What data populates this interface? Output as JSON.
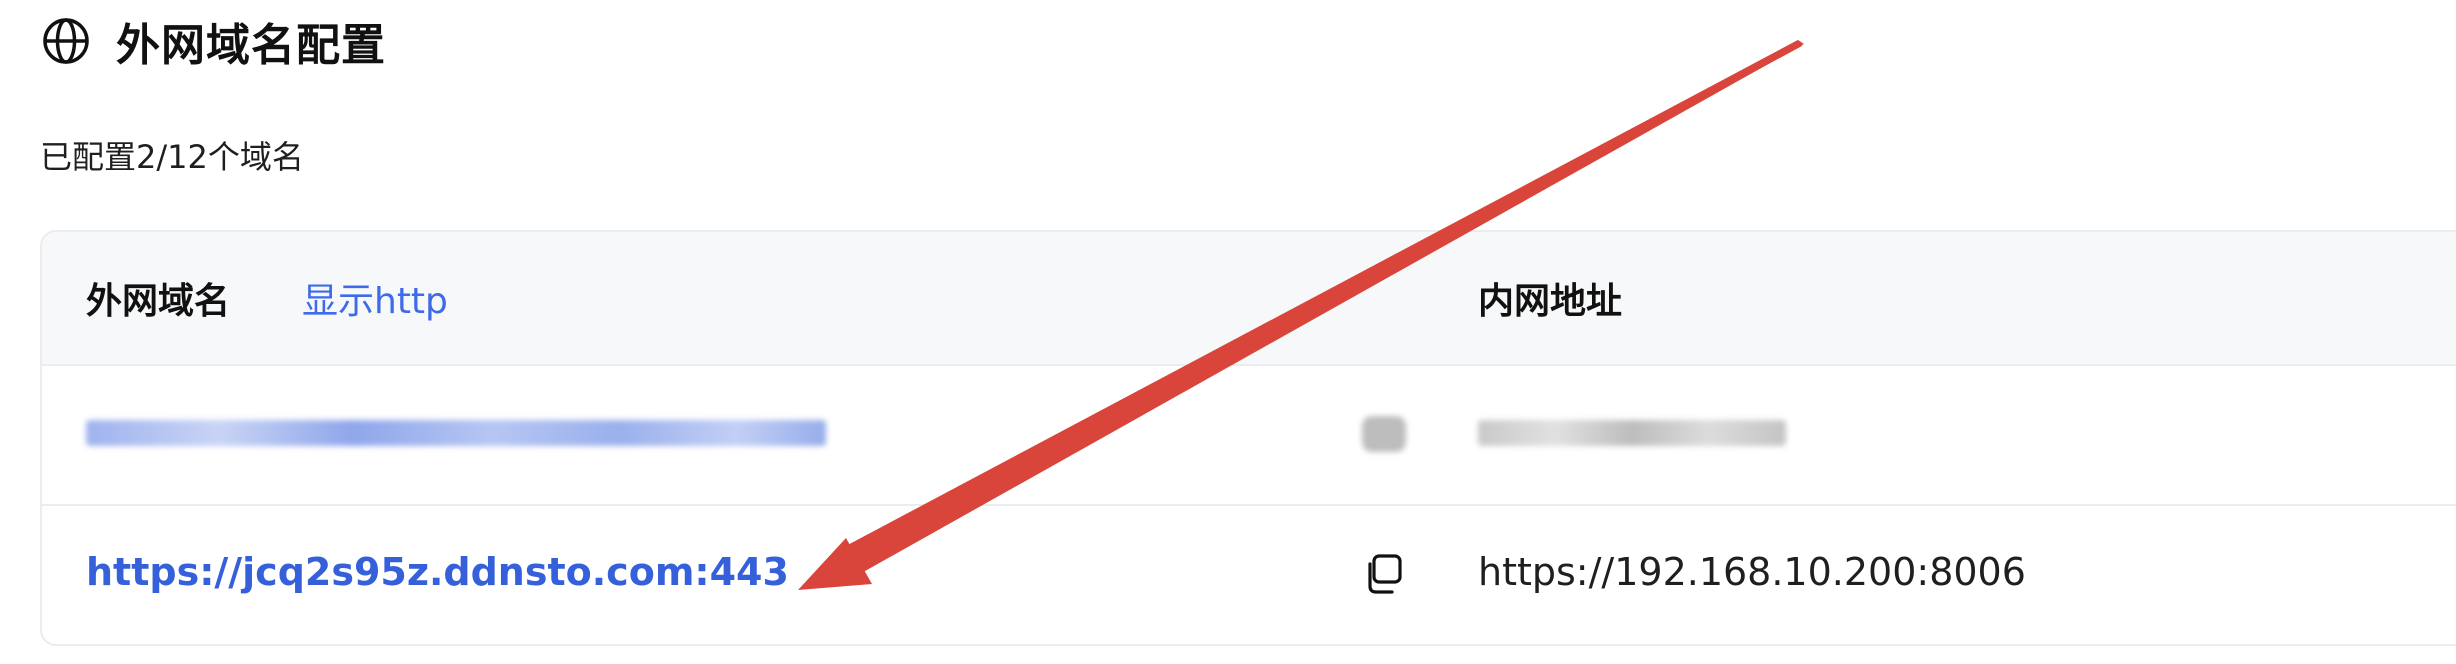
{
  "header": {
    "title": "外网域名配置",
    "icon": "globe-icon"
  },
  "summary": "已配置2/12个域名",
  "table": {
    "col_domain": "外网域名",
    "toggle_http_label": "显示http",
    "col_internal": "内网地址",
    "rows": [
      {
        "domain": "",
        "internal": "",
        "blurred": true
      },
      {
        "domain": "https://jcq2s95z.ddnsto.com:443",
        "internal": "https://192.168.10.200:8006",
        "blurred": false
      }
    ]
  },
  "colors": {
    "link": "#3560d9",
    "accent": "#3f6ae8",
    "arrow": "#d9453b",
    "header_bg": "#f7f8fa",
    "border": "#ebecef"
  }
}
